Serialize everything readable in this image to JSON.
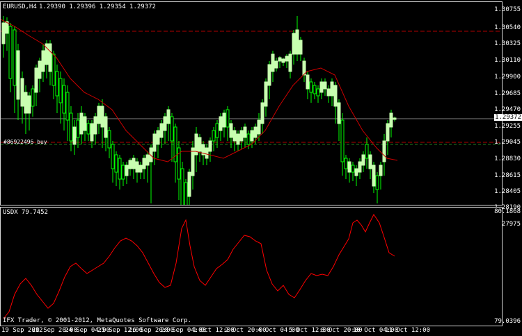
{
  "header": {
    "symbol": "EURUSD,H4",
    "ohlc": "1.29390 1.29396 1.29354 1.29372"
  },
  "order_label": "#86922496 buy",
  "current_price": "1.29372",
  "price_axis": [
    "1.30755",
    "1.30540",
    "1.30325",
    "1.30110",
    "1.29900",
    "1.29685",
    "1.29470",
    "1.29255",
    "1.29045",
    "1.28830",
    "1.28615",
    "1.28405",
    "1.28190",
    "1.27975"
  ],
  "indicator": {
    "name": "USDX",
    "value": "79.7452",
    "axis_top": "80.1868",
    "axis_bottom": "79.0396"
  },
  "copyright": "IFX Trader, © 2001-2012, MetaQuotes Software Corp.",
  "time_axis": [
    "19 Sep 2012",
    "20 Sep 20:00",
    "24 Sep 04:00",
    "25 Sep 12:00",
    "26 Sep 20:00",
    "28 Sep 04:00",
    "1 Oct 12:00",
    "2 Oct 20:00",
    "4 Oct 04:00",
    "5 Oct 12:00",
    "8 Oct 20:00",
    "10 Oct 04:00",
    "11 Oct 12:00"
  ],
  "colors": {
    "background": "#000000",
    "bull_body": "#c8ffb0",
    "wick": "#00ff00",
    "bear_body": "#000000",
    "ma_line": "#cc0000",
    "indicator_line": "#ff0000",
    "level_line": "#b00000",
    "grid_border": "#d8d8d8"
  }
}
